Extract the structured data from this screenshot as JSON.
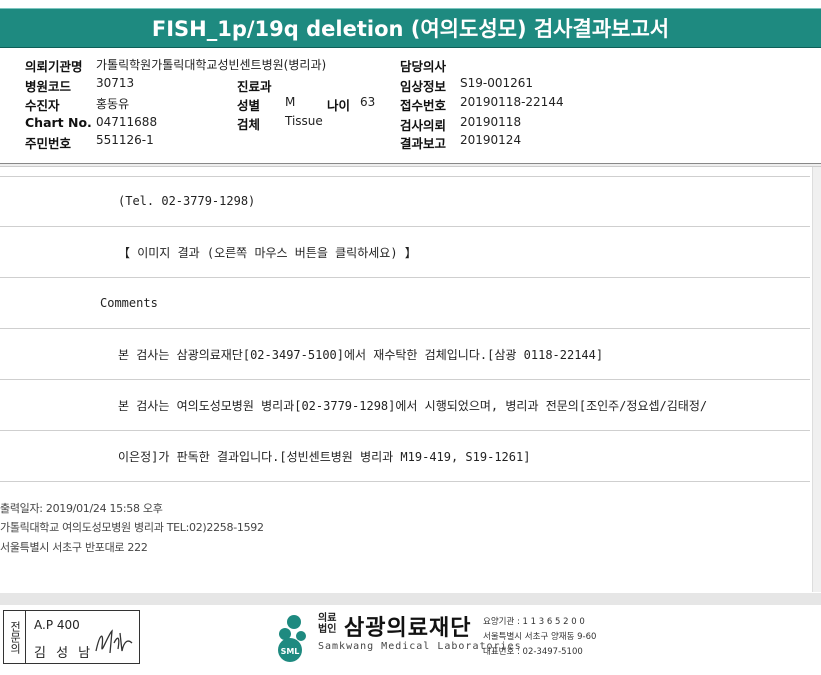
{
  "header": {
    "title": "FISH_1p/19q deletion (여의도성모) 검사결과보고서"
  },
  "patient": {
    "institution_label": "의뢰기관명",
    "institution_value": "가톨릭학원가톨릭대학교성빈센트병원(병리과)",
    "hospital_code_label": "병원코드",
    "hospital_code_value": "30713",
    "dept_label": "진료과",
    "dept_value": "",
    "doctor_label": "담당의사",
    "doctor_value": "",
    "recipient_label": "수진자",
    "recipient_value": "홍동유",
    "sex_label": "성별",
    "sex_value": "M",
    "age_label": "나이",
    "age_value": "63",
    "chart_label": "Chart No.",
    "chart_value": "04711688",
    "specimen_label": "검체",
    "specimen_value": "Tissue",
    "resident_label": "주민번호",
    "resident_value": "551126-1",
    "clinical_label": "임상정보",
    "clinical_value": "S19-001261",
    "receipt_label": "접수번호",
    "receipt_value": "20190118-22144",
    "request_label": "검사의뢰",
    "request_value": "20190118",
    "report_label": "결과보고",
    "report_value": "20190124"
  },
  "report_rows": [
    "(Tel. 02-3779-1298)",
    "【 이미지 결과 (오른쪽 마우스 버튼을 클릭하세요) 】",
    "Comments",
    "본 검사는 삼광의료재단[02-3497-5100]에서 재수탁한 검체입니다.[삼광 0118-22144]",
    "본 검사는 여의도성모병원 병리과[02-3779-1298]에서 시행되었으며, 병리과 전문의[조인주/정요셉/김태정/",
    "이은정]가 판독한 결과입니다.[성빈센트병원 병리과 M19-419, S19-1261]"
  ],
  "footer": {
    "print_date": "출력일자: 2019/01/24 15:58 오후",
    "dept_contact": "가톨릭대학교 여의도성모병원 병리과 TEL:02)2258-1592",
    "address": "서울특별시 서초구 반포대로 222"
  },
  "signature": {
    "side_label": "전문의",
    "license": "A.P 400",
    "name": "김 성 남"
  },
  "logo": {
    "corp_line1": "의료",
    "corp_line2": "법인",
    "name_ko": "삼광의료재단",
    "name_en": "Samkwang Medical Laboratories",
    "badge": "SML",
    "code_line": "요양기관 : 1 1 3 6 5 2 0 0",
    "address_line": "서울특별시 서초구 양재동 9-60",
    "phone_line": "대표번호 : 02-3497-5100",
    "accent_color": "#1e8a80"
  }
}
